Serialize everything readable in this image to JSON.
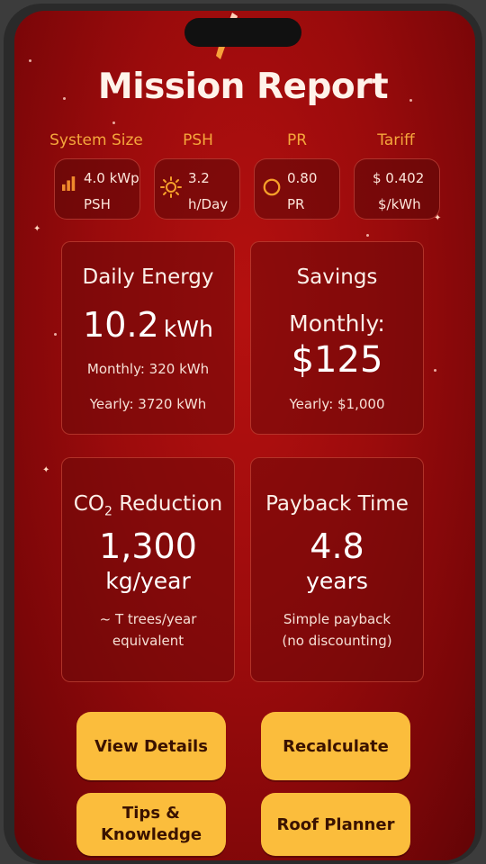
{
  "header": {
    "title": "Mission Report"
  },
  "params": [
    {
      "label": "System Size",
      "value": "4.0 kWp",
      "sub": "PSH",
      "icon": "bar-chart-icon"
    },
    {
      "label": "PSH",
      "value": "3.2",
      "sub": "h/Day",
      "icon": "sun-icon"
    },
    {
      "label": "PR",
      "value": "0.80",
      "sub": "PR",
      "icon": "circle-icon"
    },
    {
      "label": "Tariff",
      "value": "$ 0.402",
      "sub": "$/kWh",
      "icon": ""
    }
  ],
  "cards": {
    "daily_energy": {
      "title": "Daily Energy",
      "value": "10.2",
      "unit": "kWh",
      "monthly": "Monthly: 320 kWh",
      "yearly": "Yearly: 3720 kWh"
    },
    "savings": {
      "title": "Savings",
      "label": "Monthly:",
      "value": "$125",
      "yearly": "Yearly: $1,000"
    },
    "co2": {
      "title_prefix": "CO",
      "title_sub": "2",
      "title_suffix": " Reduction",
      "value": "1,300",
      "unit": "kg/year",
      "note1": "~ T trees/year",
      "note2": "equivalent"
    },
    "payback": {
      "title": "Payback Time",
      "value": "4.8",
      "unit": "years",
      "note1": "Simple payback",
      "note2": "(no discounting)"
    }
  },
  "buttons": {
    "view_details": "View Details",
    "recalculate": "Recalculate",
    "tips_line1": "Tips &",
    "tips_line2": "Knowledge",
    "roof_planner": "Roof Planner"
  },
  "colors": {
    "background": "#a10c0c",
    "accent": "#f5a73c",
    "button": "#fbbd3c"
  }
}
